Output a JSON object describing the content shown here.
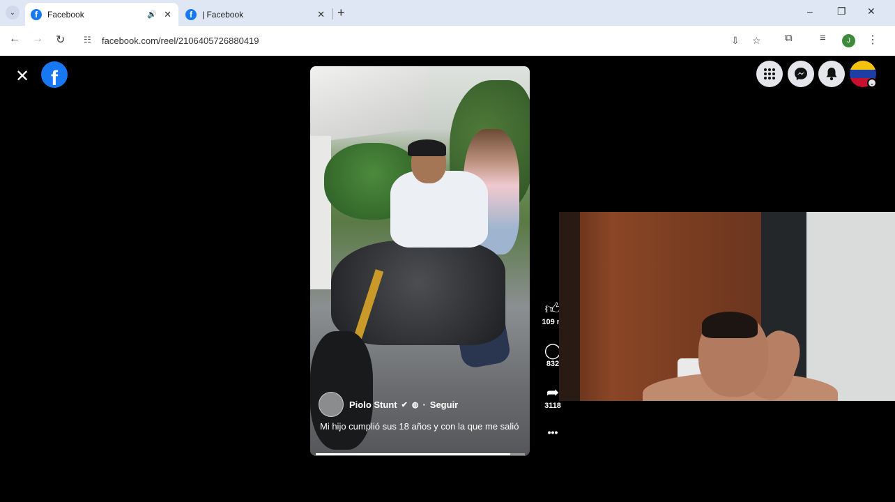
{
  "browser": {
    "tabs": [
      {
        "title": "Facebook",
        "active": true,
        "audio_icon": "speaker-icon"
      },
      {
        "title": "| Facebook",
        "active": false
      }
    ],
    "new_tab": "+",
    "url": "facebook.com/reel/2106405726880419",
    "window_controls": {
      "minimize": "–",
      "restore": "❐",
      "close": "✕"
    },
    "profile_initial": "J"
  },
  "facebook": {
    "logo_letter": "f",
    "close": "✕",
    "top_buttons": [
      "menu-grid-icon",
      "messenger-icon",
      "notifications-bell-icon",
      "account-avatar"
    ]
  },
  "reel": {
    "author": "Piolo Stunt",
    "follow": "Seguir",
    "caption": "Mi hijo cumplió sus 18 años y con la que me salió",
    "progress": 0.93
  },
  "actions": {
    "likes": "109 m",
    "comments": "832",
    "shares": "3118",
    "more": "•••"
  },
  "colors": {
    "fb_blue": "#1877f2",
    "chrome_bar": "#dfe7f4",
    "background": "#000000"
  }
}
